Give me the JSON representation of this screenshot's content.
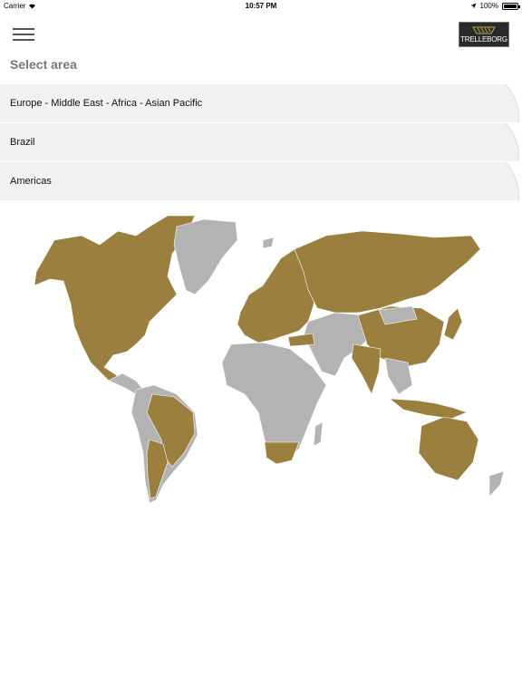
{
  "status_bar": {
    "carrier": "Carrier",
    "time": "10:57 PM",
    "battery": "100%",
    "battery_level": 1.0,
    "icons": [
      "wifi-icon",
      "location-arrow-icon",
      "battery-icon"
    ]
  },
  "header": {
    "menu_icon": "hamburger-menu-icon",
    "logo_text": "TRELLEBORG"
  },
  "page": {
    "title": "Select area"
  },
  "areas": [
    {
      "label": "Europe - Middle East - Africa - Asian Pacific"
    },
    {
      "label": "Brazil"
    },
    {
      "label": "Americas"
    }
  ],
  "colors": {
    "highlight_region": "#9a7f3f",
    "other_region": "#b3b3b3",
    "list_bg": "#f1f1f1",
    "title_gray": "#777777"
  }
}
